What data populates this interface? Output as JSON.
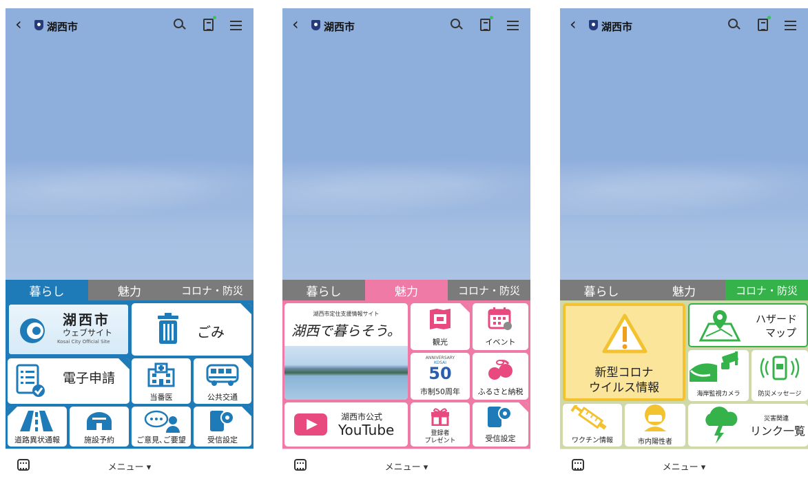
{
  "header": {
    "title": "湖西市"
  },
  "bottom": {
    "menu_label": "メニュー ▾"
  },
  "tabs": [
    "暮らし",
    "魅力",
    "コロナ・防災"
  ],
  "colors": {
    "sky": "#8eaedc",
    "blue_theme": "#1f7ab8",
    "pink_theme": "#ef7aa5",
    "yellow_theme": "#f2c230",
    "green_theme": "#35b24a"
  },
  "screens": [
    {
      "active_tab": "暮らし",
      "tiles": {
        "website_title": "湖西市",
        "website_sub": "ウェブサイト",
        "website_en": "Kosai City Official Site",
        "gomi": "ごみ",
        "e_application": "電子申請",
        "touban": "当番医",
        "transport": "公共交通",
        "road": "道路異状通報",
        "facility": "施設予約",
        "opinion": "ご意見､ご要望",
        "settings": "受信設定"
      }
    },
    {
      "active_tab": "魅力",
      "tiles": {
        "banner_title": "湖西市定住支援情報サイト",
        "banner_script": "湖西で暮らそう。",
        "kanko": "観光",
        "event": "イベント",
        "anniv_badge": "ANNIVERSARY",
        "anniv_en": "KOSAI",
        "anniv_num": "50",
        "anniv": "市制50周年",
        "furusato": "ふるさと納税",
        "youtube_line1": "湖西市公式",
        "youtube_line2": "YouTube",
        "present_line1": "登録者",
        "present_line2": "プレゼント",
        "settings": "受信設定"
      }
    },
    {
      "active_tab": "コロナ・防災",
      "tiles": {
        "corona_line1": "新型コロナ",
        "corona_line2": "ウイルス情報",
        "hazard_line1": "ハザード",
        "hazard_line2": "マップ",
        "camera": "海岸監視カメラ",
        "message": "防災メッセージ",
        "vaccine": "ワクチン情報",
        "positive": "市内陽性者",
        "link_small": "災害関連",
        "link": "リンク一覧"
      }
    }
  ]
}
